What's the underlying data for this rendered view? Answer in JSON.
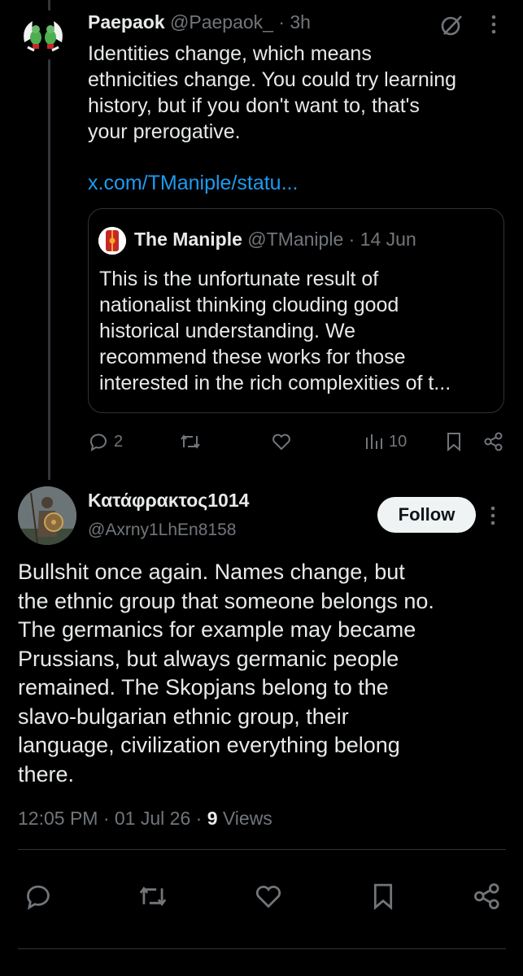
{
  "parent_tweet": {
    "display_name": "Paepaok",
    "handle": "@Paepaok_",
    "time": "· 3h",
    "body_lines": [
      "Identities change, which means",
      "ethnicities change. You could try learning",
      "history, but if you don't want to, that's",
      "your prerogative."
    ],
    "link": "x.com/TManiple/statu...",
    "quote": {
      "display_name": "The Maniple",
      "handle": "@TManiple",
      "time": "· 14 Jun",
      "body_lines": [
        "This is the unfortunate result of",
        "nationalist thinking clouding good",
        "historical understanding. We",
        "recommend these works for those",
        "interested in the rich complexities of t..."
      ]
    },
    "actions": {
      "replies": "2",
      "views": "10"
    }
  },
  "main_tweet": {
    "display_name": "Κατάφρακτος1014",
    "handle": "@Axrny1LhEn8158",
    "follow_label": "Follow",
    "body_lines": [
      "Bullshit once again. Names change, but",
      "the ethnic group that someone belongs no.",
      "The germanics for example may became",
      "Prussians, but always germanic people",
      "remained. The Skopjans belong to the",
      "slavo-bulgarian ethnic group, their",
      "language, civilization everything belong",
      "there."
    ],
    "timestamp": "12:05 PM · 01 Jul 26 · ",
    "views_count": "9",
    "views_label": " Views"
  },
  "icons": [
    "grok-icon",
    "more-icon",
    "reply-icon",
    "retweet-icon",
    "like-icon",
    "views-icon",
    "bookmark-icon",
    "share-icon"
  ],
  "colors": {
    "background": "#000000",
    "text": "#e7e9ea",
    "muted": "#71767b",
    "link": "#1d9bf0",
    "border": "#2f3336"
  }
}
